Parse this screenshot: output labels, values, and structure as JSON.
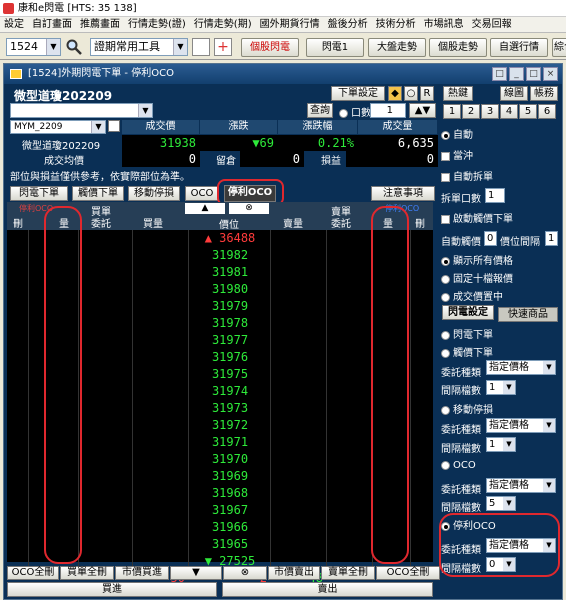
{
  "app_title": "康和e閃電 [HTS: 35 138]",
  "menu": [
    "設定",
    "自訂畫面",
    "推薦畫面",
    "行情走勢(證)",
    "行情走勢(期)",
    "國外期貨行情",
    "盤後分析",
    "技術分析",
    "市場訊息",
    "交易回報",
    "國外期貨交"
  ],
  "toolbar": {
    "code": "1524",
    "tool_combo": "證期常用工具",
    "buttons": [
      "個股閃電",
      "閃電1",
      "大盤走勢",
      "個股走勢",
      "自選行情",
      "綜合"
    ]
  },
  "window": {
    "title": "[1524]外期閃電下單 - 停利OCO",
    "buttons": [
      "□",
      "_",
      "□",
      "×"
    ]
  },
  "product": {
    "name": "微型道瓊202209",
    "order_settings": "下單設定",
    "R": "R",
    "symbol": "MYM_2209",
    "symbol_desc": "微型道瓊202209",
    "query": "查詢",
    "lots_label": "口數",
    "lots_value": "1"
  },
  "quote": {
    "headers": [
      "成交價",
      "漲跌",
      "漲跌幅",
      "成交量"
    ],
    "price": "31938",
    "change": "69",
    "change_pct": "0.21%",
    "volume": "6,635",
    "row2_labels": [
      "成交均價",
      "留倉",
      "損益"
    ],
    "avg": "0",
    "oi": "0",
    "pnl": "0"
  },
  "note": "部位與損益僅供參考，依實際部位為準。",
  "order_buttons": [
    "閃電下單",
    "觸價下單",
    "移動停損",
    "OCO",
    "停利OCO",
    "注意事項"
  ],
  "grid_headers": {
    "left_top": "停利OCO",
    "cancel": "刪",
    "qty": "量",
    "buy_order": "買單",
    "buy_order2": "委託",
    "buy_qty": "買量",
    "price": "價位",
    "sell_qty": "賣量",
    "sell_order": "賣單",
    "sell_order2": "委託",
    "right_top": "停利OCO"
  },
  "price_ladder": [
    "36488",
    "31982",
    "31981",
    "31980",
    "31979",
    "31978",
    "31977",
    "31976",
    "31975",
    "31974",
    "31973",
    "31972",
    "31971",
    "31970",
    "31969",
    "31968",
    "31967",
    "31966",
    "31965",
    "27525"
  ],
  "ladder_ops": [
    "▲",
    "⊗"
  ],
  "totals": {
    "buy": "50",
    "mid": "2",
    "sell": "48"
  },
  "bottom_buttons": [
    "OCO全刪",
    "買單全刪",
    "市價買進",
    "▼",
    "⊗",
    "市價賣出",
    "賣單全刪",
    "OCO全刪"
  ],
  "bottom_actions": [
    "買進",
    "賣出"
  ],
  "right": {
    "top_btns": [
      "熱鍵",
      "線圖",
      "帳務"
    ],
    "tabs": [
      "1",
      "2",
      "3",
      "4",
      "5",
      "6"
    ],
    "auto": "自動",
    "day_trade": "當沖",
    "auto_split": "自動拆單",
    "split_lots": "拆單口數",
    "split_lots_val": "1",
    "start_touch": "啟動觸價下單",
    "auto_touch": "自動觸價",
    "auto_touch_val": "0",
    "price_gap": "價位間隔",
    "price_gap_val": "1",
    "opts": [
      "顯示所有價格",
      "固定十檔報價",
      "成交價置中"
    ],
    "settings_tabs": [
      "閃電設定",
      "快速商品"
    ],
    "order_types": [
      "閃電下單",
      "觸價下單"
    ],
    "order_kind": "委託種類",
    "order_kind_val": "指定價格",
    "gap_ticks": "間隔檔數",
    "gap_ticks_val": "1",
    "move_stop": "移動停損",
    "move_stop_kind": "委託種類",
    "move_stop_kind_val": "指定價格",
    "move_stop_gap": "間隔檔數",
    "move_stop_gap_val": "1",
    "oco": "OCO",
    "oco_kind": "委託種類",
    "oco_kind_val": "指定價格",
    "oco_gap": "間隔檔數",
    "oco_gap_val": "5",
    "tp_oco": "停利OCO",
    "tp_kind": "委託種類",
    "tp_kind_val": "指定價格",
    "tp_gap": "間隔檔數",
    "tp_gap_val": "0"
  },
  "colors": {
    "green": "#2eea3a",
    "red": "#ff3b3b",
    "highlight": "#e0282e",
    "yellow": "#ffe600"
  }
}
